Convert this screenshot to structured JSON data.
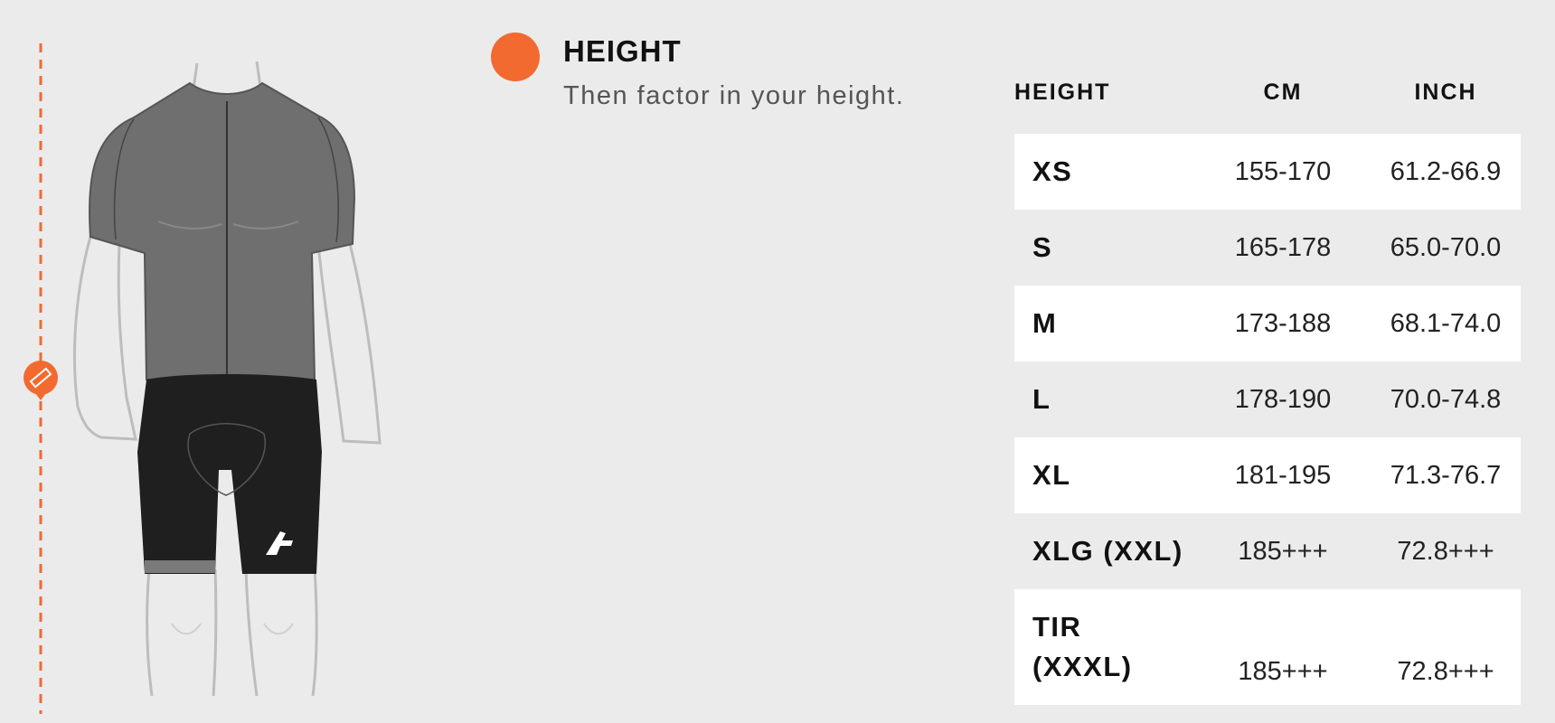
{
  "colors": {
    "accent": "#f26a30",
    "background": "#ebebeb",
    "row_white": "#ffffff"
  },
  "figure": {
    "measure_icon": "ruler-icon",
    "logo_icon": "brand-logo-icon"
  },
  "section": {
    "title": "HEIGHT",
    "subtitle": "Then factor in your height."
  },
  "table": {
    "headers": {
      "size": "HEIGHT",
      "cm": "CM",
      "inch": "INCH"
    },
    "rows": [
      {
        "size": "XS",
        "cm": "155-170",
        "inch": "61.2-66.9"
      },
      {
        "size": "S",
        "cm": "165-178",
        "inch": "65.0-70.0"
      },
      {
        "size": "M",
        "cm": "173-188",
        "inch": "68.1-74.0"
      },
      {
        "size": "L",
        "cm": "178-190",
        "inch": "70.0-74.8"
      },
      {
        "size": "XL",
        "cm": "181-195",
        "inch": "71.3-76.7"
      },
      {
        "size": "XLG (XXL)",
        "cm": "185+++",
        "inch": "72.8+++"
      },
      {
        "size": "TIR\n(XXXL)",
        "cm": "185+++",
        "inch": "72.8+++"
      }
    ]
  }
}
